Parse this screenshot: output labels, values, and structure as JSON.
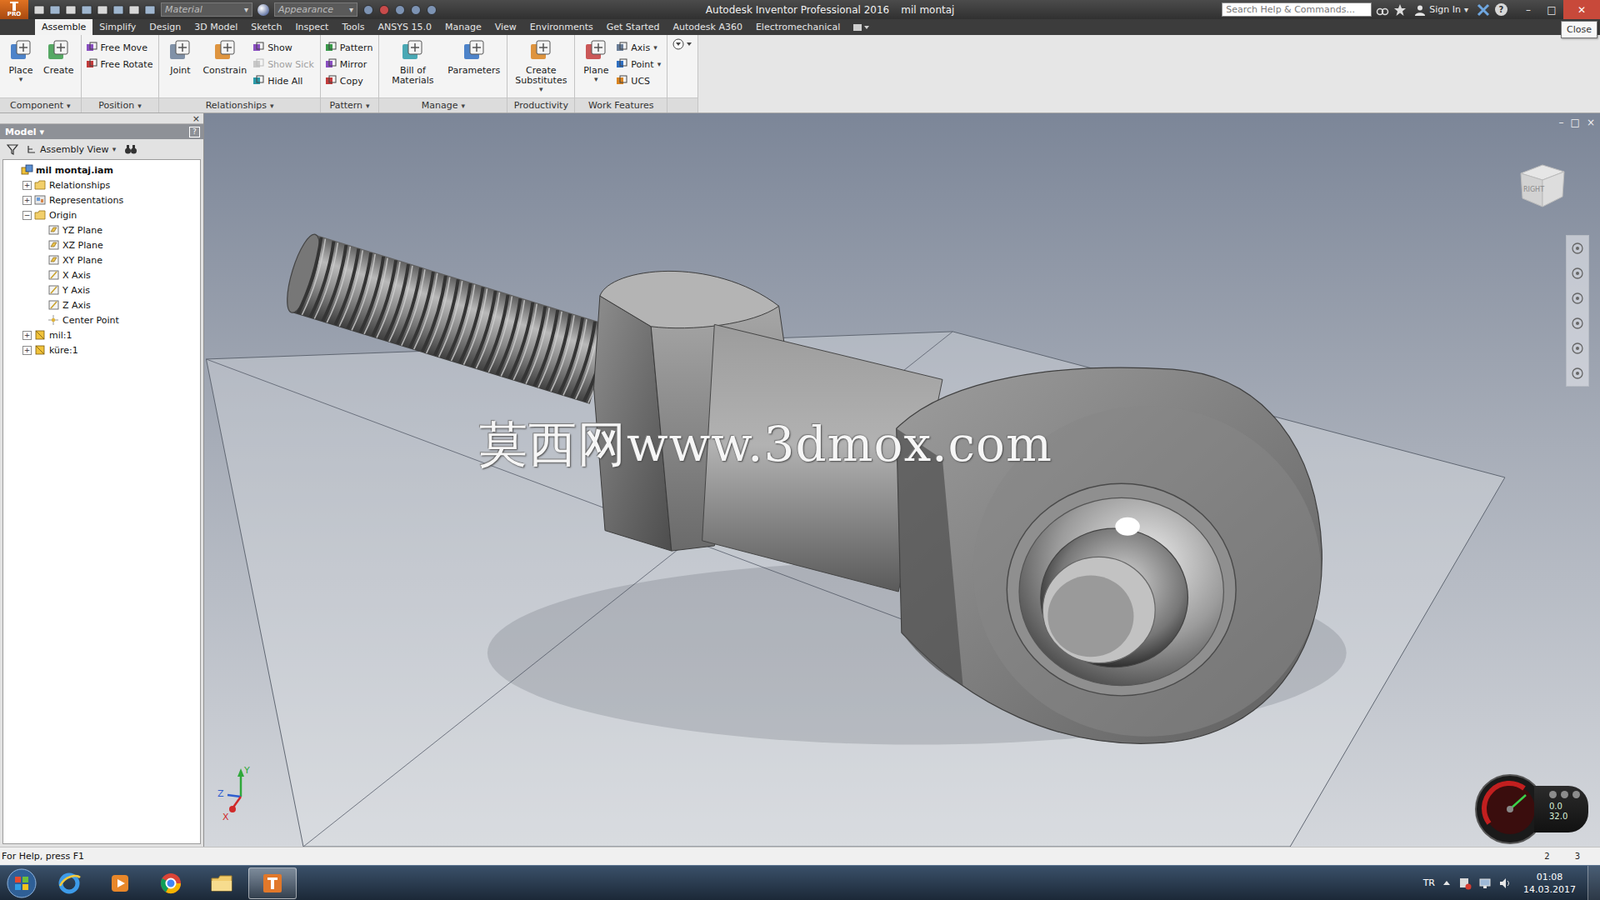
{
  "title_bar": {
    "app_badge": "PRO",
    "material": "Material",
    "appearance": "Appearance",
    "title": "Autodesk Inventor Professional 2016",
    "document": "mil montaj",
    "search_placeholder": "Search Help & Commands...",
    "sign_in": "Sign In",
    "help": "?",
    "controls": [
      "–",
      "□",
      "✕"
    ],
    "tooltip": "Close"
  },
  "dropdown_glyph": "▾",
  "ribbon_tabs": [
    {
      "label": "Assemble",
      "selected": true
    },
    {
      "label": "Simplify",
      "selected": false
    },
    {
      "label": "Design",
      "selected": false
    },
    {
      "label": "3D Model",
      "selected": false
    },
    {
      "label": "Sketch",
      "selected": false
    },
    {
      "label": "Inspect",
      "selected": false
    },
    {
      "label": "Tools",
      "selected": false
    },
    {
      "label": "ANSYS 15.0",
      "selected": false
    },
    {
      "label": "Manage",
      "selected": false
    },
    {
      "label": "View",
      "selected": false
    },
    {
      "label": "Environments",
      "selected": false
    },
    {
      "label": "Get Started",
      "selected": false
    },
    {
      "label": "Autodesk A360",
      "selected": false
    },
    {
      "label": "Electromechanical",
      "selected": false
    }
  ],
  "ribbon_groups": [
    {
      "label": "Component",
      "menu": true,
      "items": [
        {
          "kind": "large",
          "label": "Place",
          "dropdown": true,
          "disabled": false
        },
        {
          "kind": "large",
          "label": "Create",
          "dropdown": false,
          "disabled": false
        }
      ]
    },
    {
      "label": "Position",
      "menu": true,
      "items": [
        {
          "kind": "small",
          "label": "Free Move",
          "dropdown": false,
          "disabled": false
        },
        {
          "kind": "small",
          "label": "Free Rotate",
          "dropdown": false,
          "disabled": false
        }
      ]
    },
    {
      "label": "Relationships",
      "menu": true,
      "items": [
        {
          "kind": "large",
          "label": "Joint",
          "dropdown": false,
          "disabled": false
        },
        {
          "kind": "large",
          "label": "Constrain",
          "dropdown": false,
          "disabled": false
        },
        {
          "kind": "small",
          "label": "Show",
          "dropdown": false,
          "disabled": false
        },
        {
          "kind": "small",
          "label": "Show Sick",
          "dropdown": false,
          "disabled": true
        },
        {
          "kind": "small",
          "label": "Hide All",
          "dropdown": false,
          "disabled": false
        }
      ]
    },
    {
      "label": "Pattern",
      "menu": true,
      "items": [
        {
          "kind": "small",
          "label": "Pattern",
          "dropdown": false,
          "disabled": false
        },
        {
          "kind": "small",
          "label": "Mirror",
          "dropdown": false,
          "disabled": false
        },
        {
          "kind": "small",
          "label": "Copy",
          "dropdown": false,
          "disabled": false
        }
      ]
    },
    {
      "label": "Manage",
      "menu": true,
      "items": [
        {
          "kind": "large",
          "label": "Bill of Materials",
          "dropdown": false,
          "disabled": false
        },
        {
          "kind": "large",
          "label": "Parameters",
          "dropdown": false,
          "disabled": false
        }
      ]
    },
    {
      "label": "Productivity",
      "menu": false,
      "items": [
        {
          "kind": "large",
          "label": "Create Substitutes",
          "dropdown": true,
          "disabled": false
        }
      ]
    },
    {
      "label": "Work Features",
      "menu": false,
      "items": [
        {
          "kind": "large",
          "label": "Plane",
          "dropdown": true,
          "disabled": false
        },
        {
          "kind": "small",
          "label": "Axis",
          "dropdown": true,
          "disabled": false
        },
        {
          "kind": "small",
          "label": "Point",
          "dropdown": true,
          "disabled": false
        },
        {
          "kind": "small",
          "label": "UCS",
          "dropdown": false,
          "disabled": false
        }
      ]
    }
  ],
  "browser": {
    "title": "Model",
    "close": "×",
    "help": "?",
    "view": "Assembly View",
    "tree": [
      {
        "label": "mil montaj.iam",
        "level": 0,
        "kind": "assembly",
        "expandable": false,
        "expanded": false,
        "bold": true
      },
      {
        "label": "Relationships",
        "level": 1,
        "kind": "folder",
        "expandable": true,
        "expanded": false,
        "bold": false
      },
      {
        "label": "Representations",
        "level": 1,
        "kind": "representations",
        "expandable": true,
        "expanded": false,
        "bold": false
      },
      {
        "label": "Origin",
        "level": 1,
        "kind": "folder",
        "expandable": true,
        "expanded": true,
        "bold": false
      },
      {
        "label": "YZ Plane",
        "level": 2,
        "kind": "plane",
        "expandable": false,
        "expanded": false,
        "bold": false
      },
      {
        "label": "XZ Plane",
        "level": 2,
        "kind": "plane",
        "expandable": false,
        "expanded": false,
        "bold": false
      },
      {
        "label": "XY Plane",
        "level": 2,
        "kind": "plane",
        "expandable": false,
        "expanded": false,
        "bold": false
      },
      {
        "label": "X Axis",
        "level": 2,
        "kind": "axis",
        "expandable": false,
        "expanded": false,
        "bold": false
      },
      {
        "label": "Y Axis",
        "level": 2,
        "kind": "axis",
        "expandable": false,
        "expanded": false,
        "bold": false
      },
      {
        "label": "Z Axis",
        "level": 2,
        "kind": "axis",
        "expandable": false,
        "expanded": false,
        "bold": false
      },
      {
        "label": "Center Point",
        "level": 2,
        "kind": "point",
        "expandable": false,
        "expanded": false,
        "bold": false
      },
      {
        "label": "mil:1",
        "level": 1,
        "kind": "part",
        "expandable": true,
        "expanded": false,
        "bold": false
      },
      {
        "label": "küre:1",
        "level": 1,
        "kind": "part",
        "expandable": true,
        "expanded": false,
        "bold": false
      }
    ]
  },
  "expander": {
    "expanded": "−",
    "collapsed": "+"
  },
  "viewport": {
    "watermark": "莫西网www.3dmox.com",
    "viewcube_label": "RIGHT",
    "controls": [
      "–",
      "□",
      "×"
    ],
    "axes": [
      "Y",
      "Z",
      "X"
    ],
    "gauge_readings": [
      "0.0",
      "32.0"
    ]
  },
  "status_bar": {
    "text": "For Help, press F1",
    "pages": [
      "2",
      "3"
    ]
  },
  "taskbar": {
    "apps": [
      {
        "kind": "ie",
        "active": false
      },
      {
        "kind": "media",
        "active": false
      },
      {
        "kind": "chrome",
        "active": false
      },
      {
        "kind": "explorer",
        "active": false
      },
      {
        "kind": "inventor",
        "active": true
      }
    ],
    "language": "TR",
    "time": "01:08",
    "date": "14.03.2017"
  }
}
